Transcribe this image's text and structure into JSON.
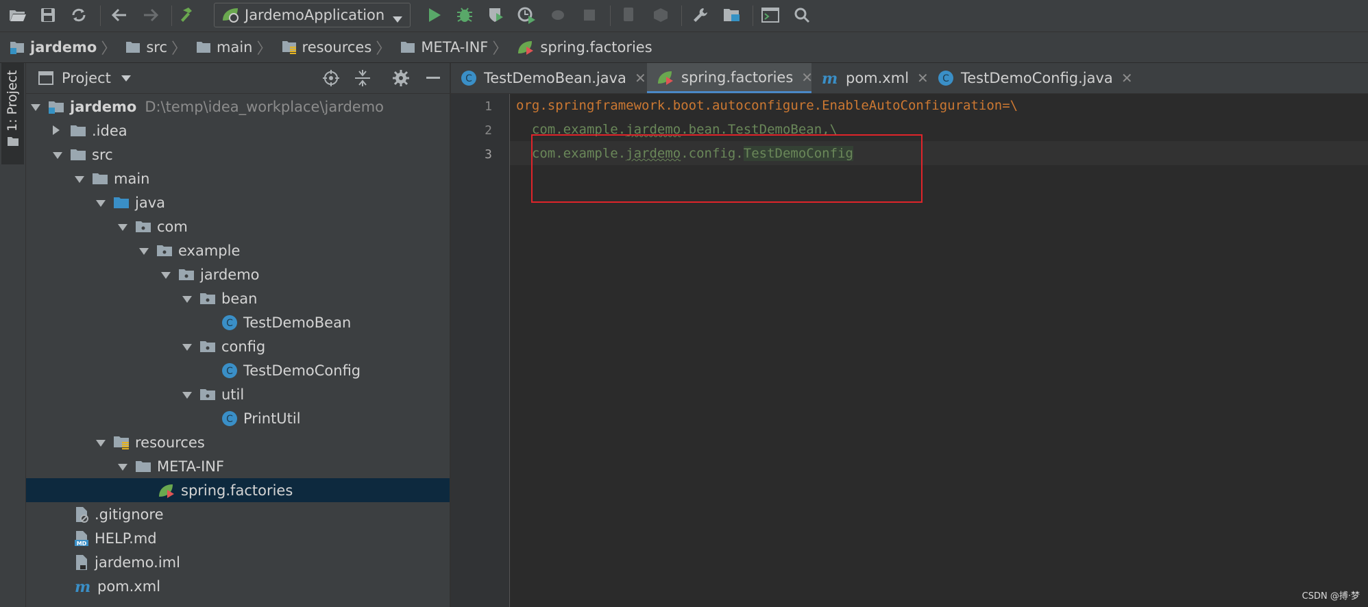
{
  "toolbar": {
    "run_config": "JardemoApplication"
  },
  "breadcrumb": {
    "items": [
      "jardemo",
      "src",
      "main",
      "resources",
      "META-INF",
      "spring.factories"
    ]
  },
  "sidebar": {
    "tab_label": "1: Project"
  },
  "project_panel": {
    "title": "Project",
    "root_name": "jardemo",
    "root_path": "D:\\temp\\idea_workplace\\jardemo",
    "items": [
      {
        "label": ".idea"
      },
      {
        "label": "src"
      },
      {
        "label": "main"
      },
      {
        "label": "java"
      },
      {
        "label": "com"
      },
      {
        "label": "example"
      },
      {
        "label": "jardemo"
      },
      {
        "label": "bean"
      },
      {
        "label": "TestDemoBean"
      },
      {
        "label": "config"
      },
      {
        "label": "TestDemoConfig"
      },
      {
        "label": "util"
      },
      {
        "label": "PrintUtil"
      },
      {
        "label": "resources"
      },
      {
        "label": "META-INF"
      },
      {
        "label": "spring.factories"
      },
      {
        "label": ".gitignore"
      },
      {
        "label": "HELP.md"
      },
      {
        "label": "jardemo.iml"
      },
      {
        "label": "pom.xml"
      }
    ]
  },
  "tabs": [
    {
      "label": "TestDemoBean.java"
    },
    {
      "label": "spring.factories"
    },
    {
      "label": "pom.xml"
    },
    {
      "label": "TestDemoConfig.java"
    }
  ],
  "editor": {
    "line_numbers": [
      "1",
      "2",
      "3"
    ],
    "line1": "org.springframework.boot.autoconfigure.EnableAutoConfiguration=\\",
    "line2_prefix": "  com.example.",
    "line2_word": "jardemo",
    "line2_suffix": ".bean.TestDemoBean,\\",
    "line3_prefix": "  com.example.",
    "line3_word": "jardemo",
    "line3_mid": ".config.",
    "line3_class": "TestDemoConfig"
  },
  "watermark": "CSDN @搏·梦",
  "colors": {
    "accent": "#4a88c7",
    "highlight_box": "#e0242a",
    "key": "#cc7832",
    "value": "#6a8759"
  }
}
